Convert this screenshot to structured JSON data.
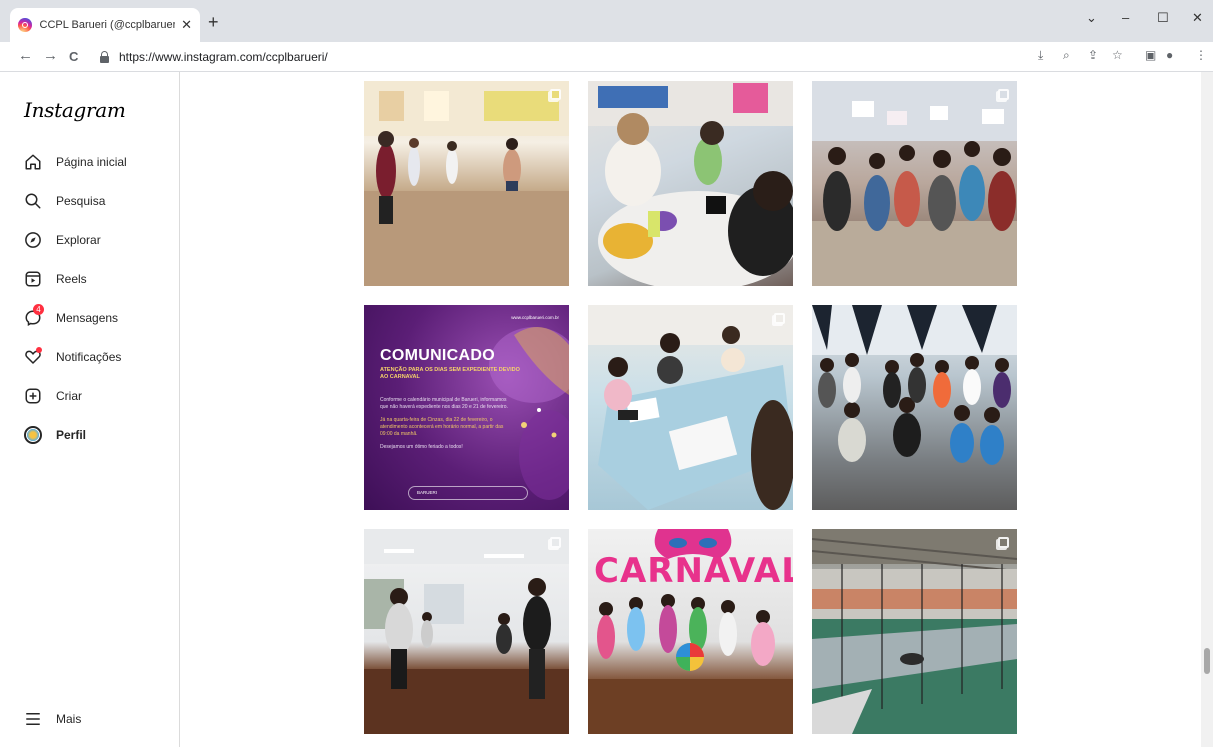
{
  "browser": {
    "tab_title": "CCPL Barueri (@ccplbarueri) • Fo",
    "tab_close": "✕",
    "new_tab": "+",
    "url": "https://www.instagram.com/ccplbarueri/",
    "controls": {
      "dropdown": "⌄",
      "minimize": "–",
      "maximize": "☐",
      "close": "✕"
    },
    "nav": {
      "back": "←",
      "forward": "→",
      "reload": "C"
    }
  },
  "sidebar": {
    "logo": "Instagram",
    "items": [
      {
        "label": "Página inicial",
        "icon": "home-icon"
      },
      {
        "label": "Pesquisa",
        "icon": "search-icon"
      },
      {
        "label": "Explorar",
        "icon": "compass-icon"
      },
      {
        "label": "Reels",
        "icon": "reels-icon"
      },
      {
        "label": "Mensagens",
        "icon": "messenger-icon",
        "badge": "4"
      },
      {
        "label": "Notificações",
        "icon": "heart-icon"
      },
      {
        "label": "Criar",
        "icon": "plus-square-icon"
      },
      {
        "label": "Perfil",
        "icon": "avatar"
      }
    ],
    "more": "Mais"
  },
  "posts": {
    "comunicado": {
      "url": "www.ccplbarueri.com.br",
      "title": "COMUNICADO",
      "subtitle": "ATENÇÃO PARA OS DIAS SEM EXPEDIENTE DEVIDO AO CARNAVAL",
      "body1": "Conforme o calendário municipal de Barueri, informamos que não haverá expediente nos dias 20 e 21 de fevereiro.",
      "body2": "Já na quarta-feira de Cinzas, dia 22 de fevereiro, o atendimento acontecerá em horário normal, a partir das 09:00 da manhã.",
      "body3": "Desejamos um ótimo feriado a todos!",
      "footer": "BARUERI"
    },
    "carnaval_banner": "CARNAVAL"
  }
}
